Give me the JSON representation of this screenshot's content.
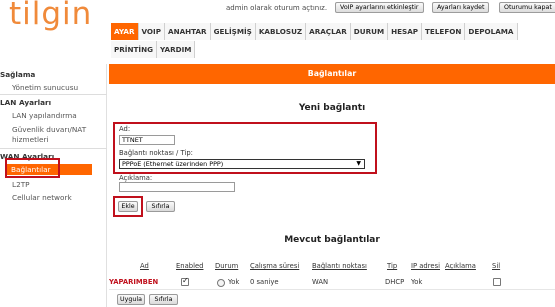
{
  "header": {
    "logo": "tilgin",
    "status_text": "admin olarak oturum açtınız.",
    "voip_button": "VoIP ayarlarını etkinleştir",
    "save_button": "Ayarları kaydet",
    "logout_button": "Oturumu kapat"
  },
  "nav": {
    "row1": [
      "AYAR",
      "VOIP",
      "ANAHTAR",
      "GELİŞMİŞ",
      "KABLOSUZ",
      "ARAÇLAR",
      "DURUM",
      "HESAP",
      "TELEFON",
      "DEPOLAMA"
    ],
    "row2": [
      "PRİNTİNG",
      "YARDIM"
    ],
    "active": "AYAR"
  },
  "sidebar": {
    "sections": [
      {
        "title": "Sağlama",
        "items": [
          "Yönetim sunucusu"
        ]
      },
      {
        "title": "LAN Ayarları",
        "items": [
          "LAN yapılandırma",
          "Güvenlik duvarı/NAT",
          "hizmetleri"
        ]
      },
      {
        "title": "WAN Ayarları",
        "items": [
          "Bağlantılar",
          "L2TP",
          "Cellular network"
        ]
      }
    ],
    "active_item": "Bağlantılar"
  },
  "main": {
    "banner": "Bağlantılar",
    "new_connection": {
      "title": "Yeni bağlantı",
      "name_label": "Ad:",
      "name_value": "TTNET",
      "endpoint_label": "Bağlantı noktası / Tip:",
      "endpoint_value": "PPPoE (Ethernet üzerinden PPP)",
      "description_label": "Açıklama:",
      "description_value": "",
      "add_button": "Ekle",
      "reset_button": "Sıfırla"
    },
    "existing": {
      "title": "Mevcut bağlantılar",
      "columns": [
        "Ad",
        "Enabled",
        "Durum",
        "Çalışma süresi",
        "Bağlantı noktası",
        "Tip",
        "IP adresi",
        "Açıklama",
        "Sil"
      ],
      "rows": [
        {
          "name": "YAPARIMBEN",
          "enabled": true,
          "status": "Yok",
          "uptime": "0 saniye",
          "port": "WAN",
          "type": "DHCP",
          "ip": "Yok",
          "description": "",
          "delete": false
        }
      ],
      "apply_button": "Uygula",
      "reset_button": "Sıfırla"
    }
  },
  "colors": {
    "accent": "#ff6600",
    "highlight_frame": "#c0101c"
  }
}
